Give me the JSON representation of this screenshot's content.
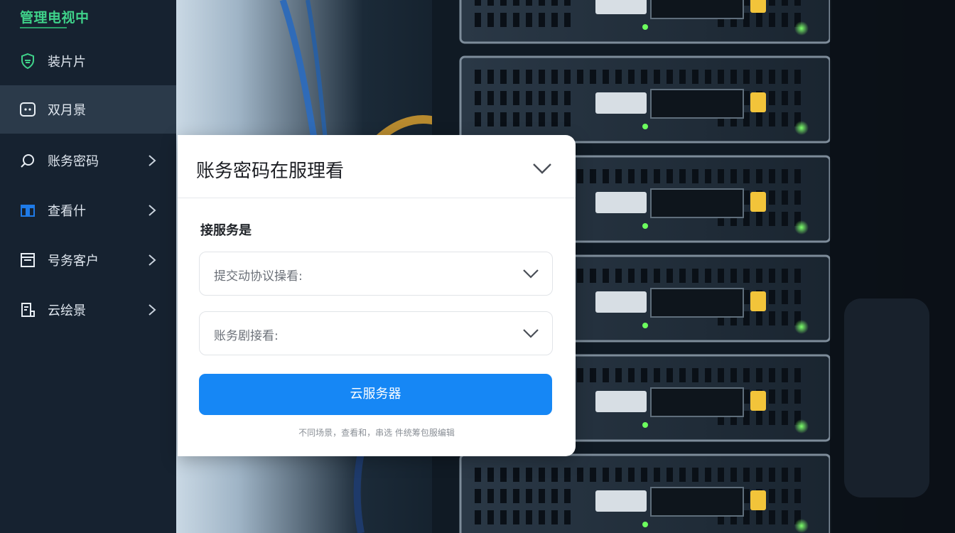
{
  "sidebar": {
    "brand": "管理电视中",
    "items": [
      {
        "label": "装片片",
        "icon": "shield-check-icon",
        "has_chevron": false
      },
      {
        "label": "双月景",
        "icon": "monitor-face-icon",
        "has_chevron": false
      },
      {
        "label": "账务密码",
        "icon": "search-icon",
        "has_chevron": true
      },
      {
        "label": "查看什",
        "icon": "calendar-icon",
        "has_chevron": true
      },
      {
        "label": "号务客户",
        "icon": "document-icon",
        "has_chevron": true
      },
      {
        "label": "云绘景",
        "icon": "file-list-icon",
        "has_chevron": true
      }
    ],
    "active_index": 1
  },
  "panel": {
    "title": "账务密码在服理看",
    "section_label": "接服务是",
    "select_1": {
      "value": "提交动协议操看:"
    },
    "select_2": {
      "value": "账务剧接看:"
    },
    "primary_button": "云服务器",
    "footnote": "不同场景，查看和，串选 件统筹包服编辑"
  },
  "colors": {
    "accent": "#1687f5",
    "brand": "#3fd28a",
    "sidebar_bg": "#162230",
    "sidebar_active": "#2b3a4a"
  },
  "background": {
    "subject": "server-rack-photo"
  }
}
